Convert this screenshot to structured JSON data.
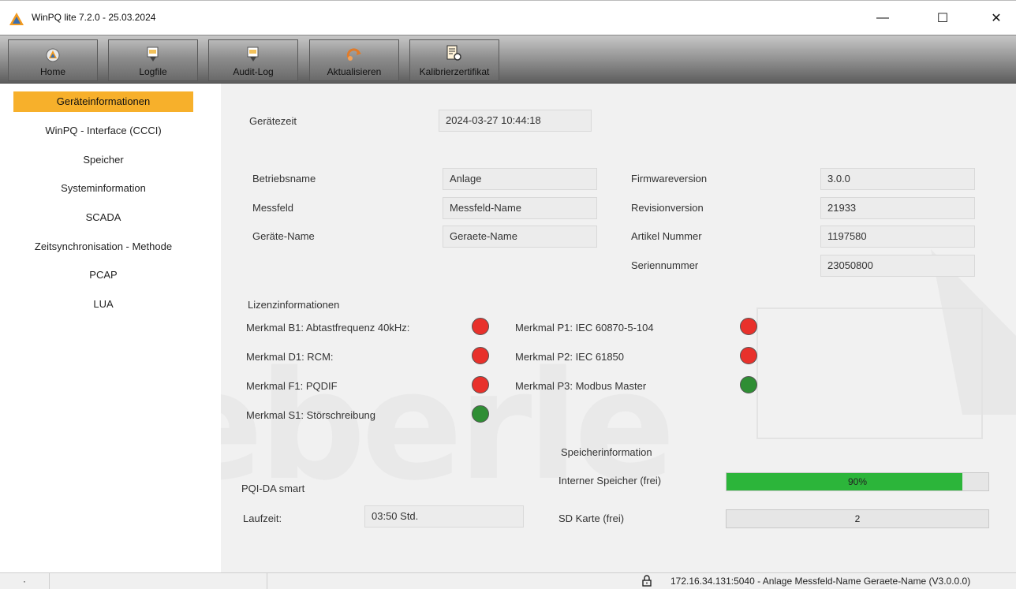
{
  "window": {
    "title": "WinPQ lite  7.2.0 - 25.03.2024",
    "controls": {
      "minimize": "—",
      "maximize": "☐",
      "close": "✕"
    }
  },
  "toolbar": {
    "buttons": [
      {
        "label": "Home",
        "icon": "home-icon"
      },
      {
        "label": "Logfile",
        "icon": "logfile-download-icon"
      },
      {
        "label": "Audit-Log",
        "icon": "audit-log-download-icon"
      },
      {
        "label": "Aktualisieren",
        "icon": "refresh-icon"
      },
      {
        "label": "Kalibrierzertifikat",
        "icon": "certificate-icon"
      }
    ]
  },
  "sidebar": {
    "items": [
      {
        "label": "Geräteinformationen",
        "active": true
      },
      {
        "label": "WinPQ - Interface (CCCI)"
      },
      {
        "label": "Speicher"
      },
      {
        "label": "Systeminformation"
      },
      {
        "label": "SCADA"
      },
      {
        "label": "Zeitsynchronisation - Methode"
      },
      {
        "label": "PCAP"
      },
      {
        "label": "LUA"
      }
    ]
  },
  "device": {
    "time_label": "Gerätezeit",
    "time_value": "2024-03-27 10:44:18",
    "left_fields": [
      {
        "label": "Betriebsname",
        "value": "Anlage"
      },
      {
        "label": "Messfeld",
        "value": "Messfeld-Name"
      },
      {
        "label": "Geräte-Name",
        "value": "Geraete-Name"
      }
    ],
    "right_fields": [
      {
        "label": "Firmwareversion",
        "value": "3.0.0"
      },
      {
        "label": "Revisionversion",
        "value": "21933"
      },
      {
        "label": "Artikel Nummer",
        "value": "1197580"
      },
      {
        "label": "Seriennummer",
        "value": "23050800"
      }
    ]
  },
  "license": {
    "title": "Lizenzinformationen",
    "left": [
      {
        "label": "Merkmal B1: Abtastfrequenz 40kHz:",
        "status": "red"
      },
      {
        "label": "Merkmal D1: RCM:",
        "status": "red"
      },
      {
        "label": "Merkmal F1: PQDIF",
        "status": "red"
      },
      {
        "label": "Merkmal S1: Störschreibung",
        "status": "green"
      }
    ],
    "right": [
      {
        "label": "Merkmal P1: IEC 60870-5-104",
        "status": "red"
      },
      {
        "label": "Merkmal P2: IEC 61850",
        "status": "red"
      },
      {
        "label": "Merkmal P3: Modbus Master",
        "status": "green"
      }
    ],
    "colors": {
      "red": "#e8312b",
      "green": "#2f8e34"
    }
  },
  "storage": {
    "title": "Speicherinformation",
    "internal_label": "Interner Speicher (frei)",
    "internal_value": "90%",
    "internal_fraction": 0.9,
    "sd_label": "SD Karte (frei)",
    "sd_value": "2"
  },
  "pqi": {
    "title": "PQI-DA smart",
    "runtime_label": "Laufzeit:",
    "runtime_value": "03:50 Std."
  },
  "status": {
    "left_marker": "·",
    "connection": "172.16.34.131:5040 - Anlage Messfeld-Name Geraete-Name (V3.0.0.0)"
  },
  "colors": {
    "accent": "#f7b02b",
    "progress": "#2cb53a"
  }
}
